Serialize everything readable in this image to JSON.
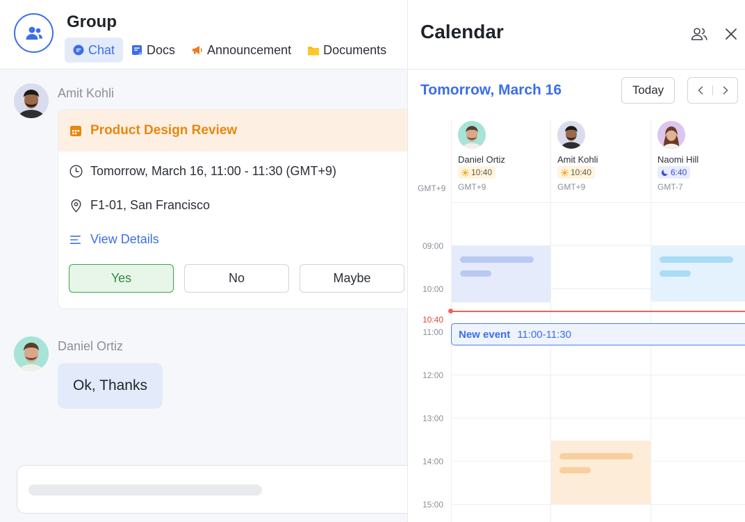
{
  "group": {
    "title": "Group",
    "tabs": [
      {
        "label": "Chat",
        "icon": "chat-bubble-icon",
        "active": true
      },
      {
        "label": "Docs",
        "icon": "docs-icon"
      },
      {
        "label": "Announcement",
        "icon": "megaphone-icon"
      },
      {
        "label": "Documents",
        "icon": "folder-icon"
      }
    ]
  },
  "messages": [
    {
      "sender": "Amit Kohli",
      "event": {
        "title": "Product Design Review",
        "time": "Tomorrow, March 16, 11:00 - 11:30 (GMT+9)",
        "location": "F1-01, San Francisco",
        "details_link": "View Details",
        "rsvp": {
          "yes": "Yes",
          "no": "No",
          "maybe": "Maybe",
          "selected": "yes"
        }
      }
    },
    {
      "sender": "Daniel Ortiz",
      "text": "Ok, Thanks"
    }
  ],
  "calendar": {
    "title": "Calendar",
    "date": "Tomorrow, March 16",
    "today_button": "Today",
    "local_tz": "GMT+9",
    "participants": [
      {
        "name": "Daniel Ortiz",
        "local_time": "10:40",
        "tz": "GMT+9",
        "daytime": "sun-icon"
      },
      {
        "name": "Amit Kohli",
        "local_time": "10:40",
        "tz": "GMT+9",
        "daytime": "sun-icon"
      },
      {
        "name": "Naomi Hill",
        "local_time": "6:40",
        "tz": "GMT-7",
        "daytime": "moon-icon"
      }
    ],
    "hours": [
      "09:00",
      "10:00",
      "11:00",
      "12:00",
      "13:00",
      "14:00",
      "15:00"
    ],
    "current_time": "10:40",
    "new_event": {
      "label": "New event",
      "time": "11:00-11:30"
    },
    "colors": {
      "accent": "#3b6ee8",
      "busy_blue": "#e5ebfb",
      "busy_cyan": "#e3f2fd",
      "busy_orange": "#fdecd8",
      "now_line": "#f0625a"
    }
  }
}
